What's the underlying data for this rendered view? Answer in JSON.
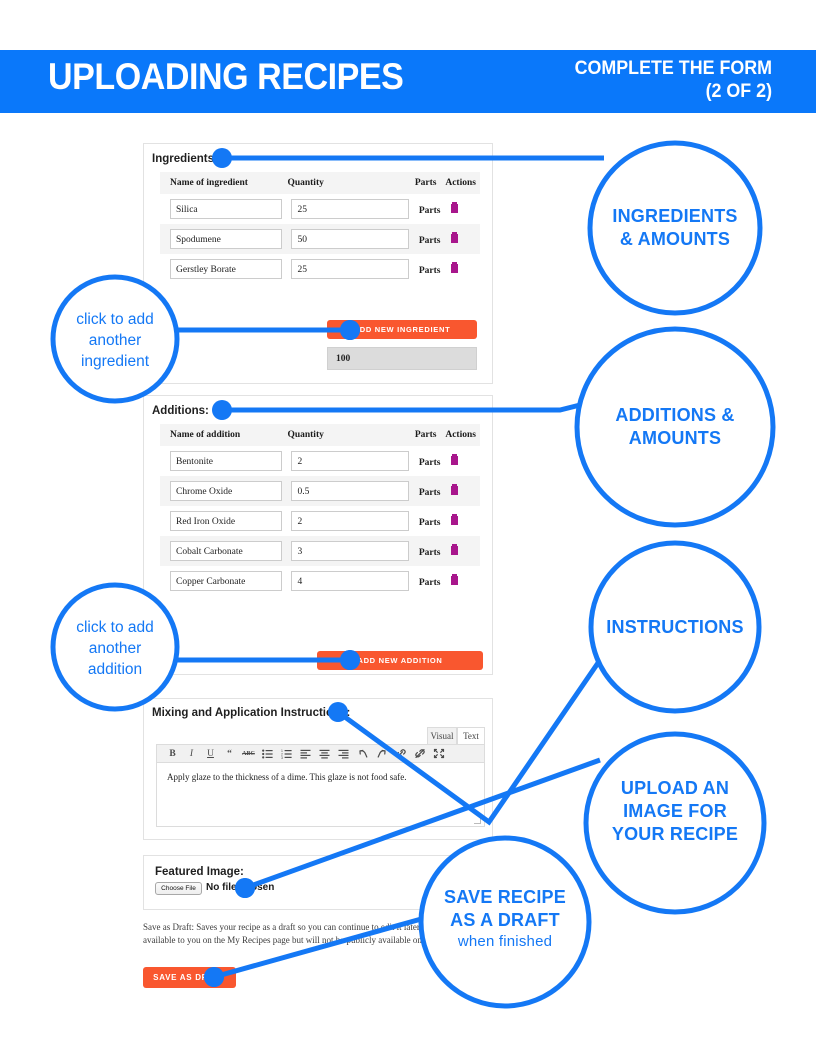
{
  "header": {
    "title": "UPLOADING RECIPES",
    "subtitle_line1": "COMPLETE THE FORM",
    "subtitle_line2": "(2 OF 2)",
    "bg_color": "#0a78fa"
  },
  "colors": {
    "accent_blue": "#1478f5",
    "button_orange": "#f9572f",
    "delete_icon": "#a8168c"
  },
  "ingredients_section": {
    "label": "Ingredients:",
    "columns": [
      "Name of ingredient",
      "Quantity",
      "Parts",
      "Actions"
    ],
    "rows": [
      {
        "name": "Silica",
        "quantity": "25",
        "parts": "Parts",
        "action_icon": "trash-icon"
      },
      {
        "name": "Spodumene",
        "quantity": "50",
        "parts": "Parts",
        "action_icon": "trash-icon"
      },
      {
        "name": "Gerstley Borate",
        "quantity": "25",
        "parts": "Parts",
        "action_icon": "trash-icon"
      }
    ],
    "add_button": "ADD NEW INGREDIENT",
    "total": "100"
  },
  "additions_section": {
    "label": "Additions:",
    "columns": [
      "Name of addition",
      "Quantity",
      "Parts",
      "Actions"
    ],
    "rows": [
      {
        "name": "Bentonite",
        "quantity": "2",
        "parts": "Parts",
        "action_icon": "trash-icon"
      },
      {
        "name": "Chrome Oxide",
        "quantity": "0.5",
        "parts": "Parts",
        "action_icon": "trash-icon"
      },
      {
        "name": "Red Iron Oxide",
        "quantity": "2",
        "parts": "Parts",
        "action_icon": "trash-icon"
      },
      {
        "name": "Cobalt Carbonate",
        "quantity": "3",
        "parts": "Parts",
        "action_icon": "trash-icon"
      },
      {
        "name": "Copper Carbonate",
        "quantity": "4",
        "parts": "Parts",
        "action_icon": "trash-icon"
      }
    ],
    "add_button": "ADD NEW ADDITION"
  },
  "instructions_section": {
    "label": "Mixing and Application Instructions:",
    "tab_visual": "Visual",
    "tab_text": "Text",
    "toolbar_icons": [
      "bold-icon",
      "italic-icon",
      "underline-icon",
      "blockquote-icon",
      "strikethrough-icon",
      "bulleted-list-icon",
      "numbered-list-icon",
      "align-left-icon",
      "align-center-icon",
      "align-right-icon",
      "undo-icon",
      "redo-icon",
      "insert-link-icon",
      "remove-link-icon",
      "fullscreen-icon"
    ],
    "body_text": "Apply glaze to the thickness of a dime. This glaze is not food safe."
  },
  "featured_image_section": {
    "label": "Featured Image:",
    "choose_file_button": "Choose File",
    "no_file_text": "No file chosen"
  },
  "save_section": {
    "note": "Save as Draft: Saves your recipe as a draft so you can continue to edit it later. It will be available to you on the My Recipes page but will not be publicly available on the site",
    "button": "SAVE AS DRAFT"
  },
  "annotations": {
    "ingredients_amounts": {
      "line1": "INGREDIENTS",
      "line2": "& AMOUNTS"
    },
    "additions_amounts": {
      "line1": "ADDITIONS &",
      "line2": "AMOUNTS"
    },
    "instructions": {
      "line1": "INSTRUCTIONS"
    },
    "upload_image": {
      "line1": "UPLOAD AN",
      "line2": "IMAGE FOR",
      "line3": "YOUR RECIPE"
    },
    "save_draft": {
      "line1": "SAVE RECIPE",
      "line2": "AS A DRAFT",
      "line3": "when finished"
    },
    "add_ingredient": {
      "line1": "click to add",
      "line2": "another",
      "line3": "ingredient"
    },
    "add_addition": {
      "line1": "click to add",
      "line2": "another",
      "line3": "addition"
    }
  }
}
